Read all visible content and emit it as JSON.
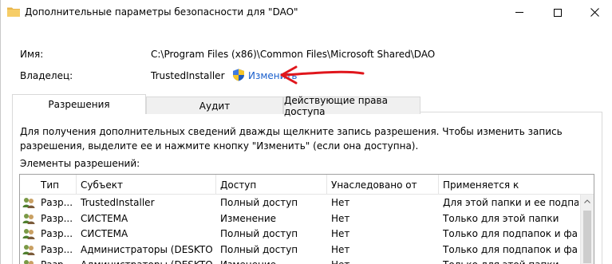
{
  "window": {
    "title": "Дополнительные параметры безопасности для \"DAO\"",
    "min_glyph": "—",
    "close_glyph": "✕"
  },
  "info": {
    "name_label": "Имя:",
    "name_value": "C:\\Program Files (x86)\\Common Files\\Microsoft Shared\\DAO",
    "owner_label": "Владелец:",
    "owner_value": "TrustedInstaller",
    "change_link": "Изменить"
  },
  "tabs": [
    {
      "label": "Разрешения",
      "active": true
    },
    {
      "label": "Аудит",
      "active": false
    },
    {
      "label": "Действующие права доступа",
      "active": false
    }
  ],
  "hint": "Для получения дополнительных сведений дважды щелкните запись разрешения. Чтобы изменить запись разрешения, выделите ее и нажмите кнопку \"Изменить\" (если она доступна).",
  "group_label": "Элементы разрешений:",
  "table": {
    "columns": [
      "Тип",
      "Субъект",
      "Доступ",
      "Унаследовано от",
      "Применяется к"
    ],
    "rows": [
      {
        "type": "Разр...",
        "subject": "TrustedInstaller",
        "access": "Полный доступ",
        "inherited": "Нет",
        "applies": "Для этой папки и ее подпап..."
      },
      {
        "type": "Разр...",
        "subject": "СИСТЕМА",
        "access": "Изменение",
        "inherited": "Нет",
        "applies": "Только для этой папки"
      },
      {
        "type": "Разр...",
        "subject": "СИСТЕМА",
        "access": "Полный доступ",
        "inherited": "Нет",
        "applies": "Только для подпапок и фай..."
      },
      {
        "type": "Разр...",
        "subject": "Администраторы (DESKTOP-...",
        "access": "Полный доступ",
        "inherited": "Нет",
        "applies": "Только для подпапок и фай..."
      },
      {
        "type": "Разр...",
        "subject": "Администраторы (DESKTOP-...",
        "access": "Изменение",
        "inherited": "Нет",
        "applies": "Только для этой папки"
      }
    ]
  },
  "colors": {
    "link": "#1a5fcc",
    "annotation_arrow": "#e0161c"
  }
}
